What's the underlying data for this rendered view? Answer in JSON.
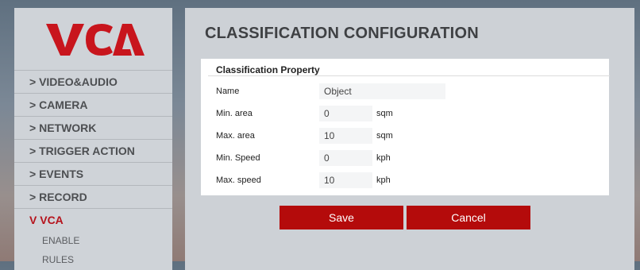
{
  "brand": {
    "logo_text": "VCA",
    "accent": "#b40b0b"
  },
  "sidebar": {
    "items": [
      {
        "label": "VIDEO&AUDIO",
        "chevron": ">"
      },
      {
        "label": "CAMERA",
        "chevron": ">"
      },
      {
        "label": "NETWORK",
        "chevron": ">"
      },
      {
        "label": "TRIGGER ACTION",
        "chevron": ">"
      },
      {
        "label": "EVENTS",
        "chevron": ">"
      },
      {
        "label": "RECORD",
        "chevron": ">"
      },
      {
        "label": "VCA",
        "chevron": "V",
        "active": true
      }
    ],
    "sub_items": [
      {
        "label": "ENABLE"
      },
      {
        "label": "RULES"
      }
    ]
  },
  "main": {
    "title": "CLASSIFICATION CONFIGURATION",
    "panel_title": "Classification Property",
    "fields": {
      "name": {
        "label": "Name",
        "value": "Object"
      },
      "min_area": {
        "label": "Min. area",
        "value": "0",
        "unit": "sqm"
      },
      "max_area": {
        "label": "Max. area",
        "value": "10",
        "unit": "sqm"
      },
      "min_speed": {
        "label": "Min. Speed",
        "value": "0",
        "unit": "kph"
      },
      "max_speed": {
        "label": "Max. speed",
        "value": "10",
        "unit": "kph"
      }
    },
    "buttons": {
      "save": "Save",
      "cancel": "Cancel"
    }
  }
}
